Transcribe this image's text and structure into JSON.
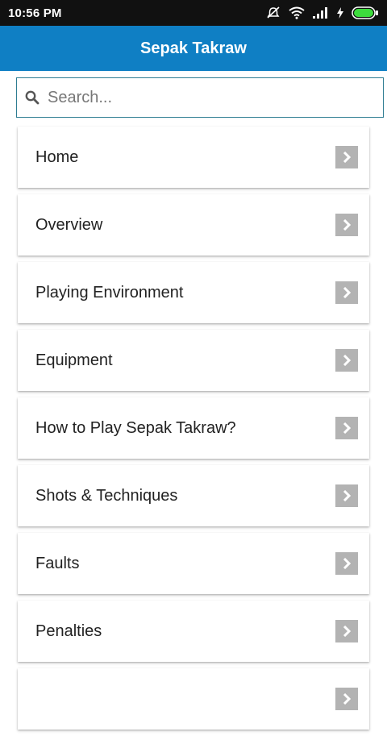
{
  "status_bar": {
    "time": "10:56 PM"
  },
  "header": {
    "title": "Sepak Takraw"
  },
  "search": {
    "placeholder": "Search..."
  },
  "menu": {
    "items": [
      {
        "label": "Home"
      },
      {
        "label": "Overview"
      },
      {
        "label": "Playing Environment"
      },
      {
        "label": "Equipment"
      },
      {
        "label": "How to Play Sepak Takraw?"
      },
      {
        "label": "Shots & Techniques"
      },
      {
        "label": "Faults"
      },
      {
        "label": "Penalties"
      },
      {
        "label": ""
      }
    ]
  },
  "colors": {
    "app_bar": "#0f7fc4",
    "status_bar": "#111111",
    "search_border": "#2e7d92",
    "chevron_bg": "#b3b3b3",
    "battery": "#3ddc3d"
  },
  "icons": [
    "mute-icon",
    "wifi-icon",
    "signal-icon",
    "charging-icon",
    "battery-icon",
    "search-icon",
    "chevron-right-icon"
  ]
}
